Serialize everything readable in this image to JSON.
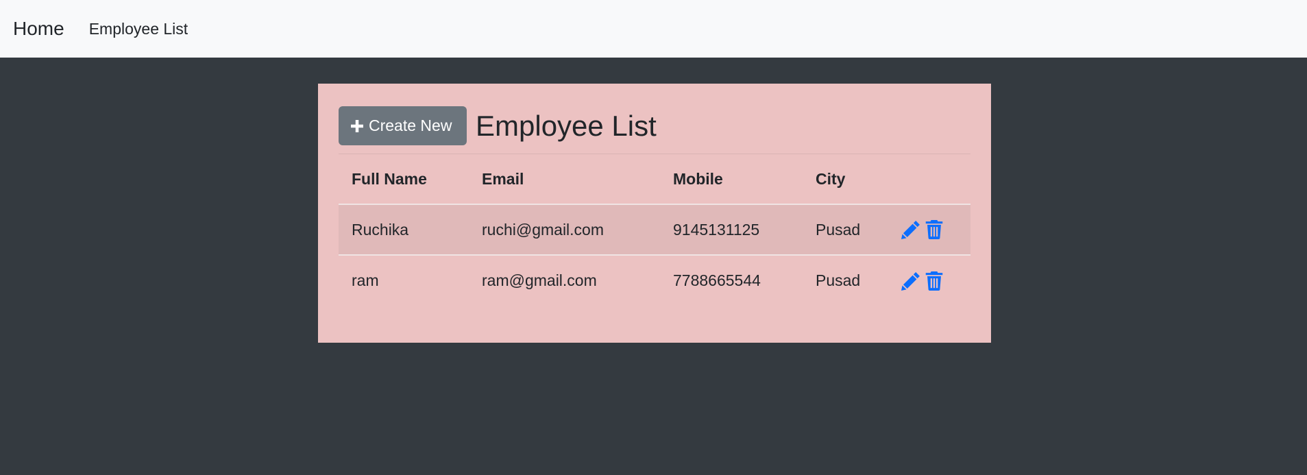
{
  "navbar": {
    "brand": "Home",
    "links": [
      "Employee List"
    ]
  },
  "page": {
    "create_button_label": "Create New",
    "title": "Employee List"
  },
  "table": {
    "headers": [
      "Full Name",
      "Email",
      "Mobile",
      "City"
    ],
    "rows": [
      {
        "full_name": "Ruchika",
        "email": "ruchi@gmail.com",
        "mobile": "9145131125",
        "city": "Pusad"
      },
      {
        "full_name": "ram",
        "email": "ram@gmail.com",
        "mobile": "7788665544",
        "city": "Pusad"
      }
    ]
  },
  "icons": {
    "create": "plus-icon",
    "edit": "pencil-icon",
    "delete": "trash-icon"
  },
  "colors": {
    "navbar_bg": "#f8f9fa",
    "page_bg": "#343a40",
    "card_bg": "#ecc2c2",
    "button_bg": "#6c757d",
    "icon_blue": "#0d6efd"
  }
}
